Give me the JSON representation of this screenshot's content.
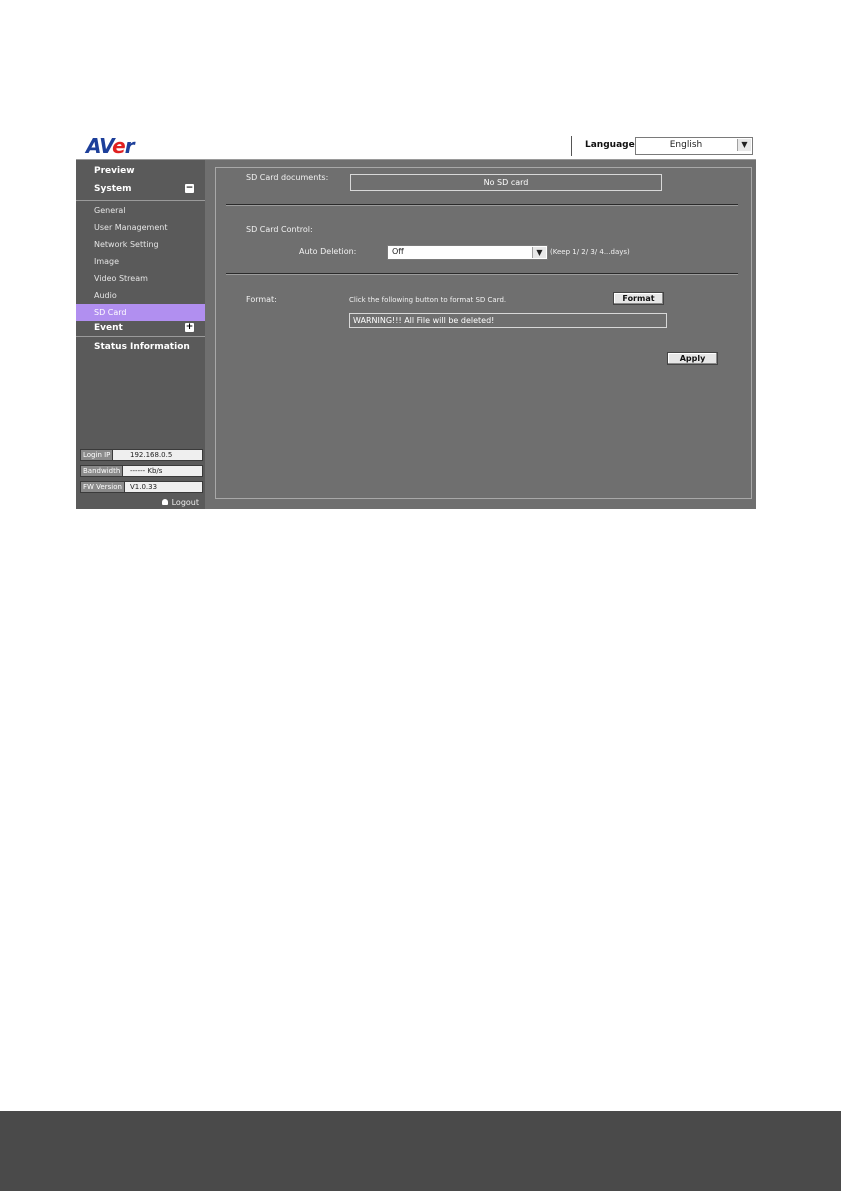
{
  "header": {
    "logo_prefix": "AV",
    "logo_accent": "e",
    "logo_suffix": "r",
    "language_label": "Language",
    "language_value": "English"
  },
  "sidebar": {
    "main_items": [
      {
        "label": "Preview"
      },
      {
        "label": "System",
        "toggle": "−"
      },
      {
        "label": "Event",
        "toggle": "+"
      },
      {
        "label": "Status Information"
      }
    ],
    "sub_items": [
      {
        "label": "General"
      },
      {
        "label": "User Management"
      },
      {
        "label": "Network Setting"
      },
      {
        "label": "Image"
      },
      {
        "label": "Video Stream"
      },
      {
        "label": "Audio"
      },
      {
        "label": "SD Card",
        "active": true
      }
    ],
    "info": [
      {
        "label": "Login IP",
        "value": "192.168.0.5"
      },
      {
        "label": "Bandwidth",
        "value": "------ Kb/s"
      },
      {
        "label": "FW Version",
        "value": "V1.0.33"
      }
    ],
    "logout_label": "Logout"
  },
  "main": {
    "sd_documents_label": "SD Card documents:",
    "sd_documents_value": "No SD card",
    "sd_control_label": "SD Card Control:",
    "auto_deletion_label": "Auto Deletion:",
    "auto_deletion_value": "Off",
    "auto_deletion_hint": "(Keep 1/ 2/ 3/ 4...days)",
    "format_label": "Format:",
    "format_hint": "Click the following button to format SD Card.",
    "format_button": "Format",
    "warning_text": "WARNING!!! All File will be deleted!",
    "apply_button": "Apply"
  },
  "colors": {
    "active_menu": "#b18ff0",
    "panel_bg": "#6f6f6f",
    "sidebar_bg": "#5a5a5a"
  }
}
